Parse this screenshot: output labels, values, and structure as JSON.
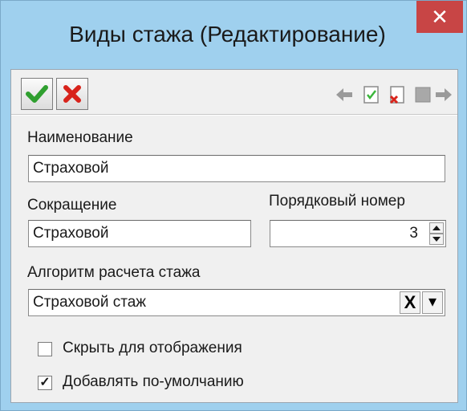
{
  "window": {
    "title": "Виды стажа (Редактирование)",
    "close_glyph": "✕"
  },
  "toolbar": {
    "buttons": [
      {
        "icon": "check-icon",
        "color": "#3bb63b"
      },
      {
        "icon": "cross-icon",
        "color": "#e0261e"
      }
    ],
    "nav_icons": [
      "arrow-left-icon",
      "check-doc-icon",
      "delete-doc-icon",
      "square-icon",
      "arrow-right-icon"
    ]
  },
  "form": {
    "name_label": "Наименование",
    "name_value": "Страховой",
    "abbr_label": "Сокращение",
    "abbr_value": "Страховой",
    "order_label": "Порядковый номер",
    "order_value": "3",
    "algo_label": "Алгоритм расчета стажа",
    "algo_value": "Страховой стаж",
    "clear_glyph": "X",
    "dropdown_glyph": "▾",
    "hide_label": "Скрыть для отображения",
    "hide_checked": false,
    "default_label": "Добавлять по-умолчанию",
    "default_checked": true,
    "checkmark_glyph": "✓"
  }
}
